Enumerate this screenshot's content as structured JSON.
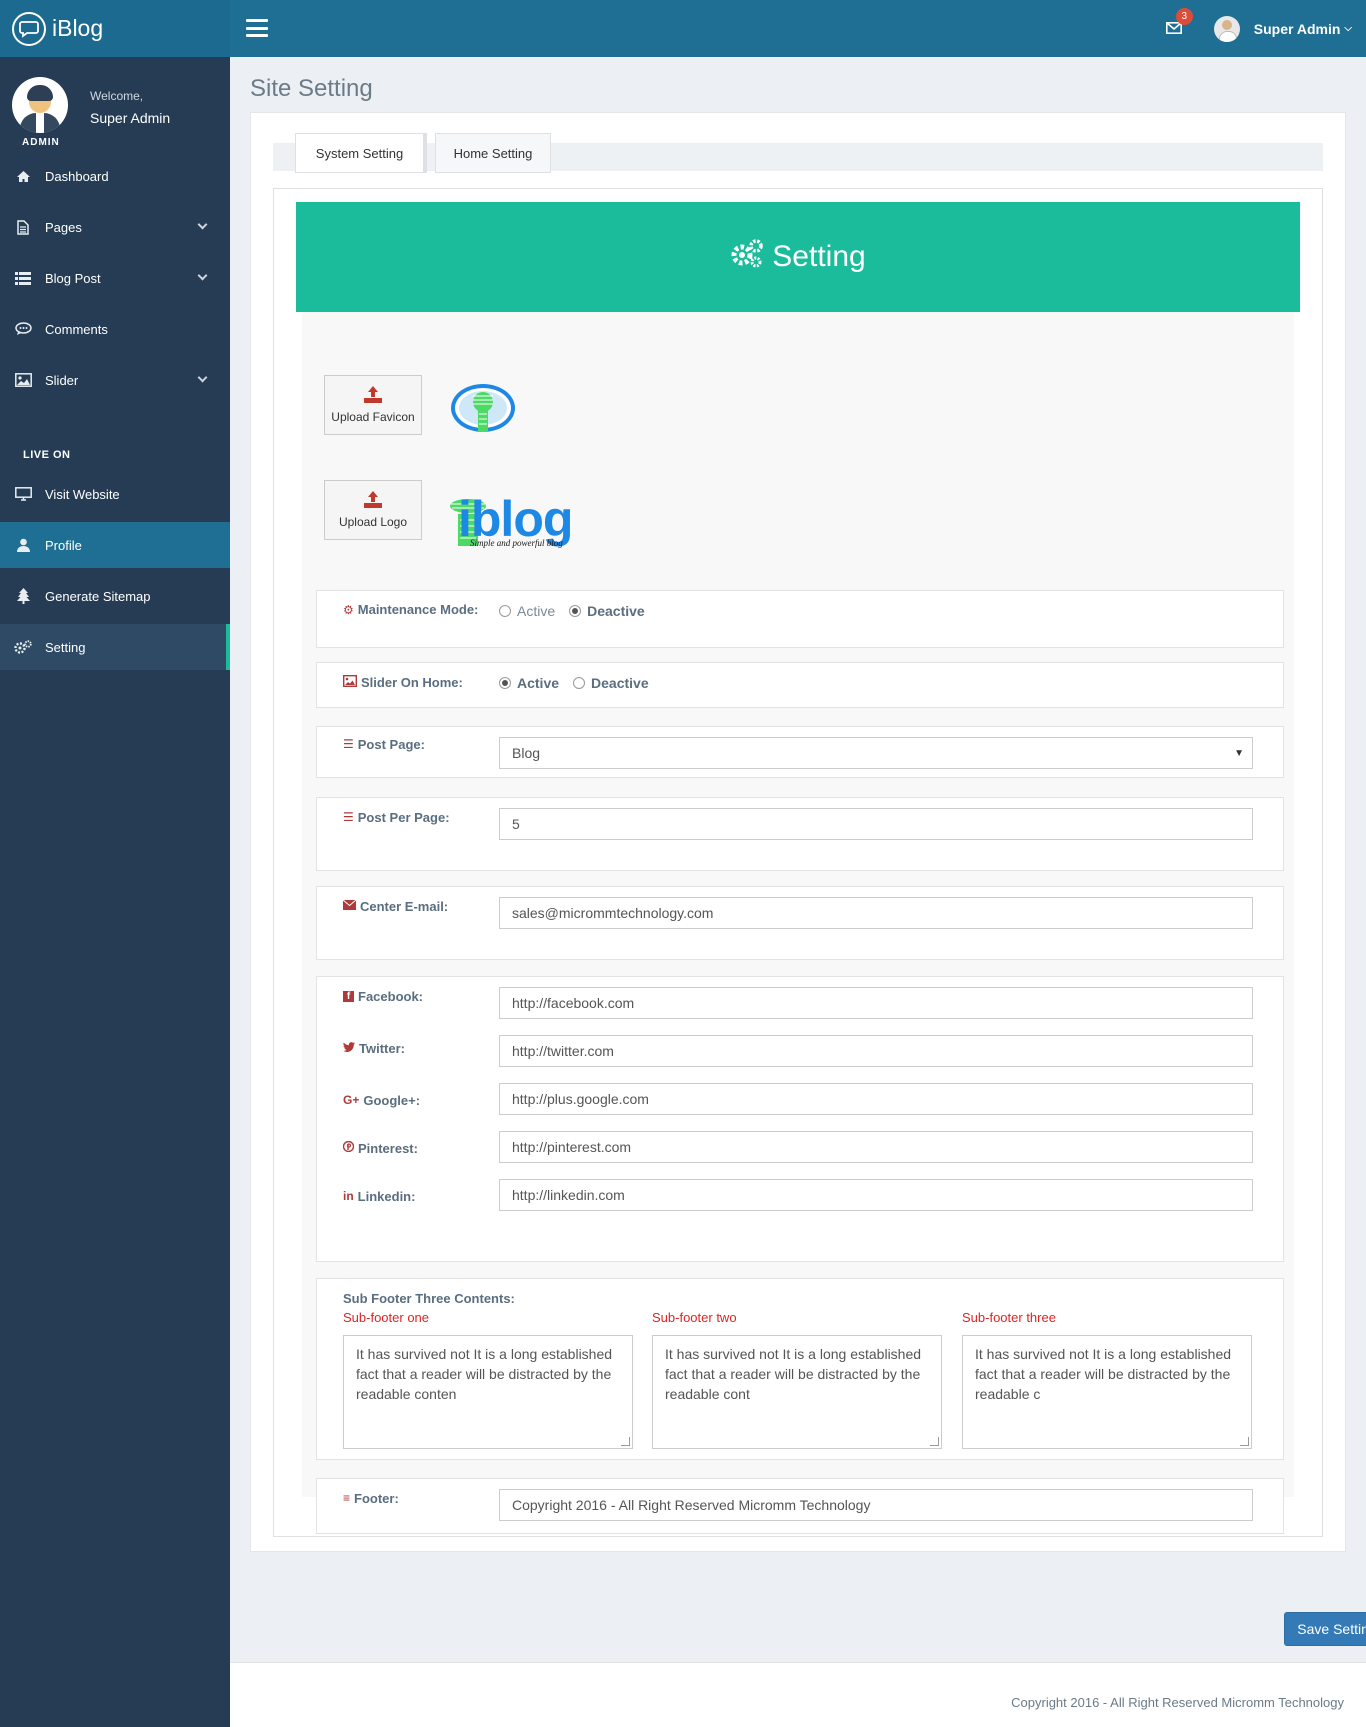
{
  "brand": {
    "name": "iBlog"
  },
  "header": {
    "mail_count": "3",
    "user_name": "Super Admin"
  },
  "sidebar": {
    "welcome": "Welcome,",
    "user_name": "Super Admin",
    "role": "ADMIN",
    "items": [
      {
        "label": "Dashboard",
        "icon": "home-icon"
      },
      {
        "label": "Pages",
        "icon": "file-icon"
      },
      {
        "label": "Blog Post",
        "icon": "list-icon"
      },
      {
        "label": "Comments",
        "icon": "comment-icon"
      },
      {
        "label": "Slider",
        "icon": "image-icon"
      }
    ],
    "section_label": "LIVE ON",
    "items2": [
      {
        "label": "Visit Website",
        "icon": "monitor-icon"
      },
      {
        "label": "Profile",
        "icon": "user-icon"
      },
      {
        "label": "Generate Sitemap",
        "icon": "tree-icon"
      },
      {
        "label": "Setting",
        "icon": "gears-icon"
      }
    ]
  },
  "page": {
    "title": "Site Setting",
    "tabs": [
      "System Setting",
      "Home Setting"
    ],
    "banner_title": "Setting"
  },
  "form": {
    "upload_favicon": "Upload Favicon",
    "upload_logo": "Upload Logo",
    "logo_text": "iblog",
    "logo_tagline": "Simple and powerful blog",
    "maintenance_label": "Maintenance Mode:",
    "maintenance_options": [
      "Active",
      "Deactive"
    ],
    "maintenance_selected": "Deactive",
    "slider_label": "Slider On Home:",
    "slider_options": [
      "Active",
      "Deactive"
    ],
    "slider_selected": "Active",
    "post_page_label": "Post Page:",
    "post_page_value": "Blog",
    "post_per_page_label": "Post Per Page:",
    "post_per_page_value": "5",
    "email_label": "Center E-mail:",
    "email_value": "sales@micrommtechnology.com",
    "facebook_label": "Facebook:",
    "facebook_value": "http://facebook.com",
    "twitter_label": "Twitter:",
    "twitter_value": "http://twitter.com",
    "google_label": "Google+:",
    "google_value": "http://plus.google.com",
    "pinterest_label": "Pinterest:",
    "pinterest_value": "http://pinterest.com",
    "linkedin_label": "Linkedin:",
    "linkedin_value": "http://linkedin.com",
    "subfooter_title": "Sub Footer Three Contents:",
    "subfooter_labels": [
      "Sub-footer one",
      "Sub-footer two",
      "Sub-footer three"
    ],
    "subfooter_values": [
      "It has survived not It is a long established fact that a reader will be distracted by the readable conten",
      "It has survived not It is a long established fact that a reader will be distracted by the readable cont",
      "It has survived not It is a long established fact that a reader will be distracted by the readable c"
    ],
    "footer_label": "Footer:",
    "footer_value": "Copyright 2016 - All Right Reserved Micromm Technology",
    "save_label": "Save Setting"
  },
  "page_footer": {
    "text": "Copyright 2016 - All Right Reserved Micromm Technology"
  },
  "colors": {
    "accent": "#1abc9c",
    "header": "#1f6e94",
    "sidebar": "#253c54",
    "primary_button": "#337ab7",
    "label_icon": "#b03a3a",
    "subfooter_label": "#e02424"
  }
}
